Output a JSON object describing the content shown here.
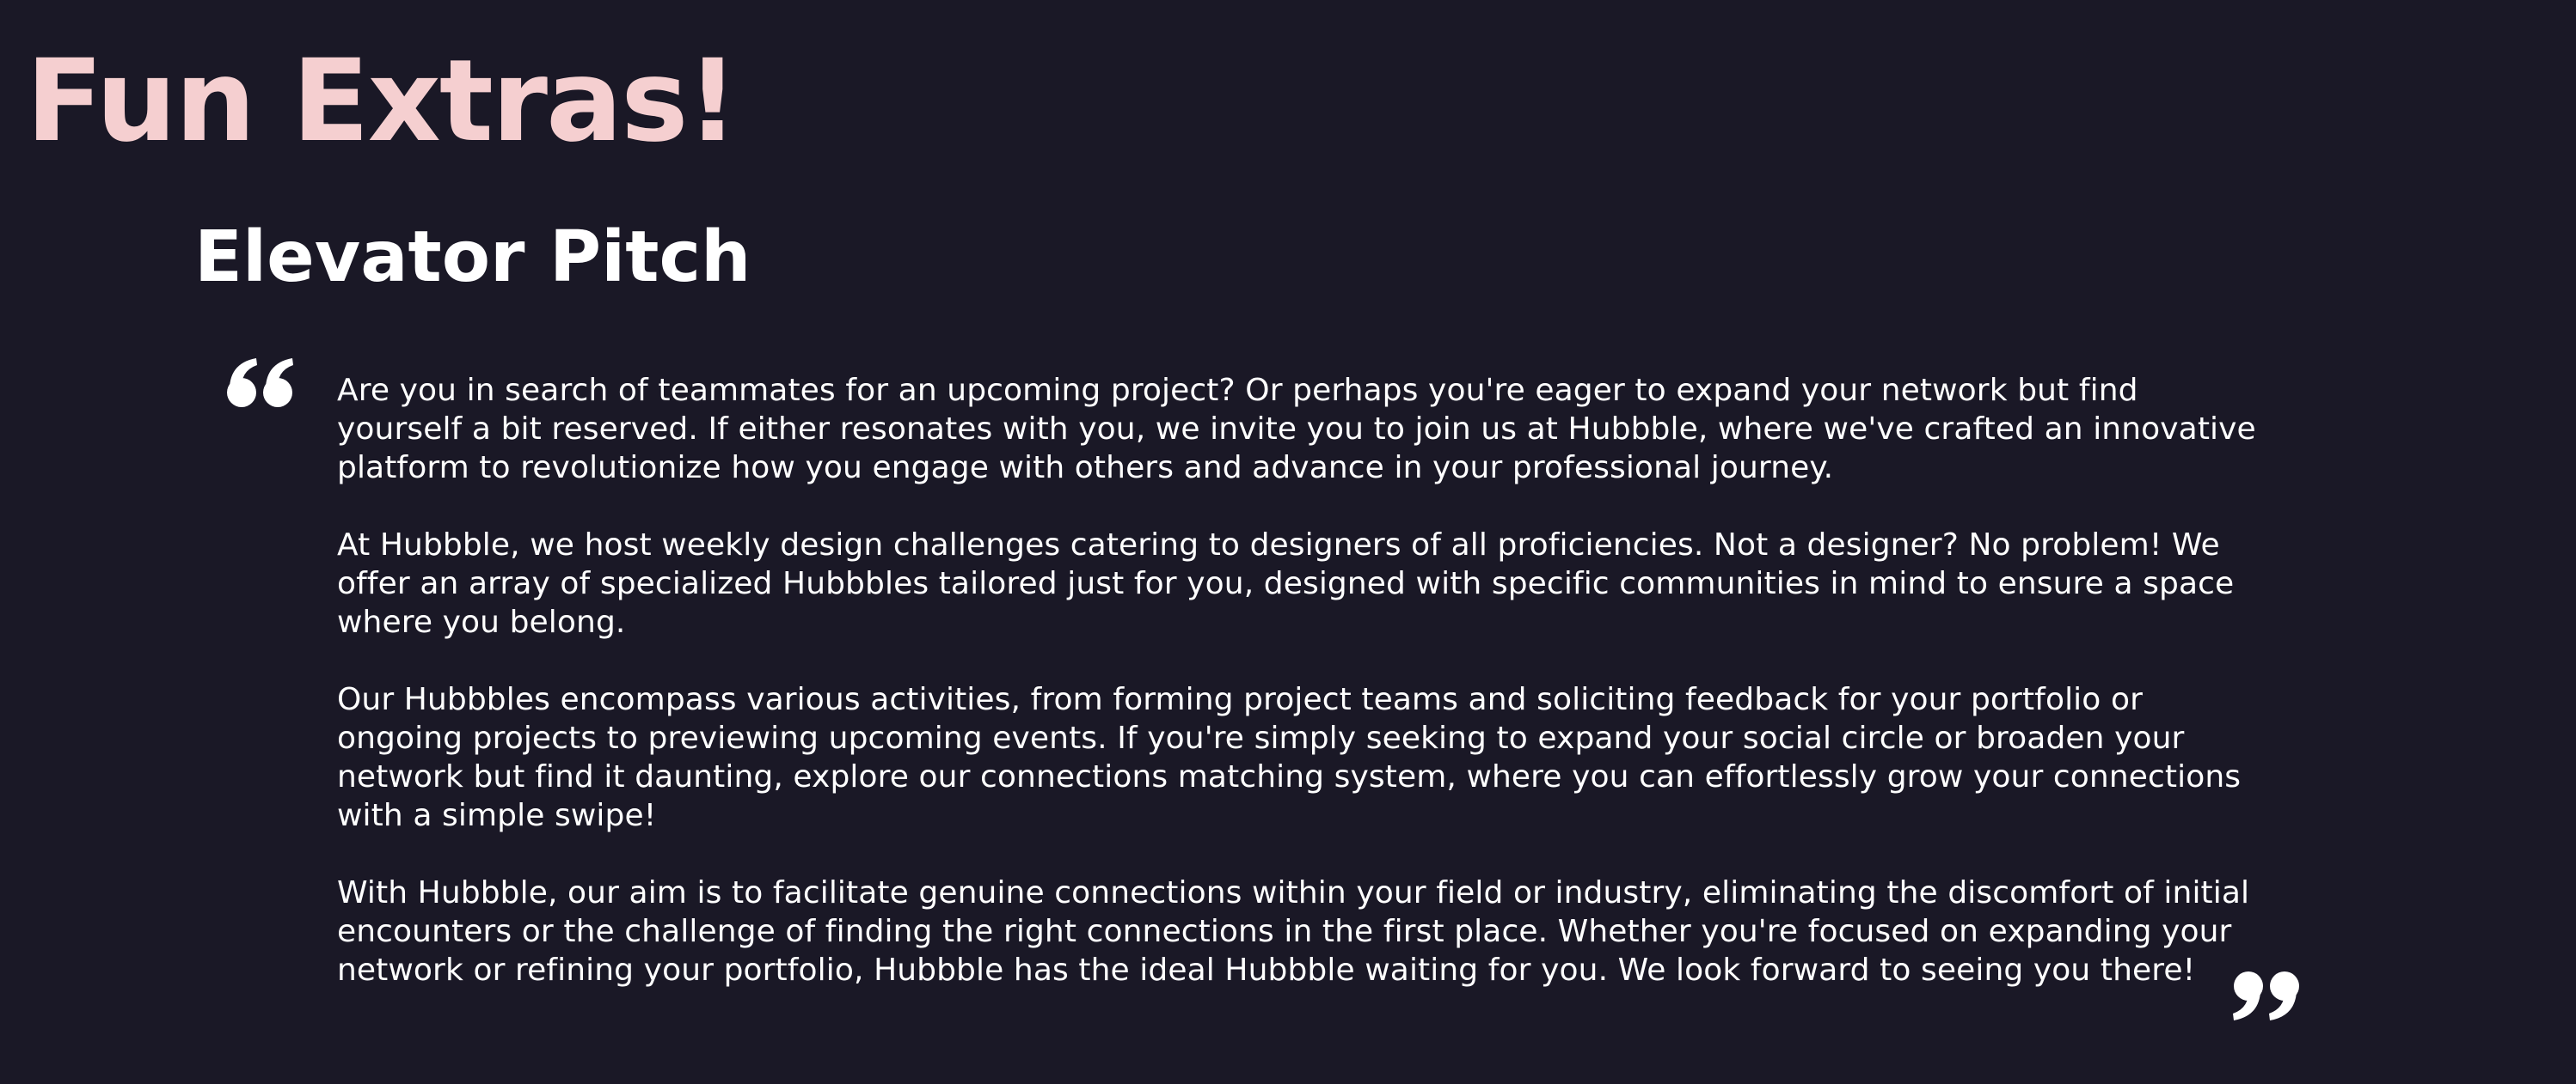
{
  "page": {
    "title": "Fun Extras!",
    "title_color": "#f5cfd0",
    "background_color": "#1a1826"
  },
  "section": {
    "heading": "Elevator Pitch",
    "open_quote_icon": "open-quote-icon",
    "close_quote_icon": "close-quote-icon",
    "paragraphs": [
      "Are you in search of teammates for an upcoming project? Or perhaps you're eager to expand your network but find yourself a bit reserved. If either resonates with you, we invite you to join us at Hubbble, where we've crafted an innovative platform to revolutionize how you engage with others and advance in your professional journey.",
      "At Hubbble, we host weekly design challenges catering to designers of all proficiencies. Not a designer? No problem! We offer an array of specialized Hubbbles tailored just for you, designed with specific communities in mind to ensure a space where you belong.",
      "Our Hubbbles encompass various activities, from forming project teams and soliciting feedback for your portfolio or ongoing projects to previewing upcoming events. If you're simply seeking to expand your social circle or broaden your network but find it daunting, explore our connections matching system, where you can effortlessly grow your connections with a simple swipe!",
      "With Hubbble, our aim is to facilitate genuine connections within your field or industry, eliminating the discomfort of initial encounters or the challenge of finding the right connections in the first place. Whether you're focused on expanding your network or refining your portfolio, Hubbble has the ideal Hubbble waiting for you. We look forward to seeing you there!"
    ]
  }
}
